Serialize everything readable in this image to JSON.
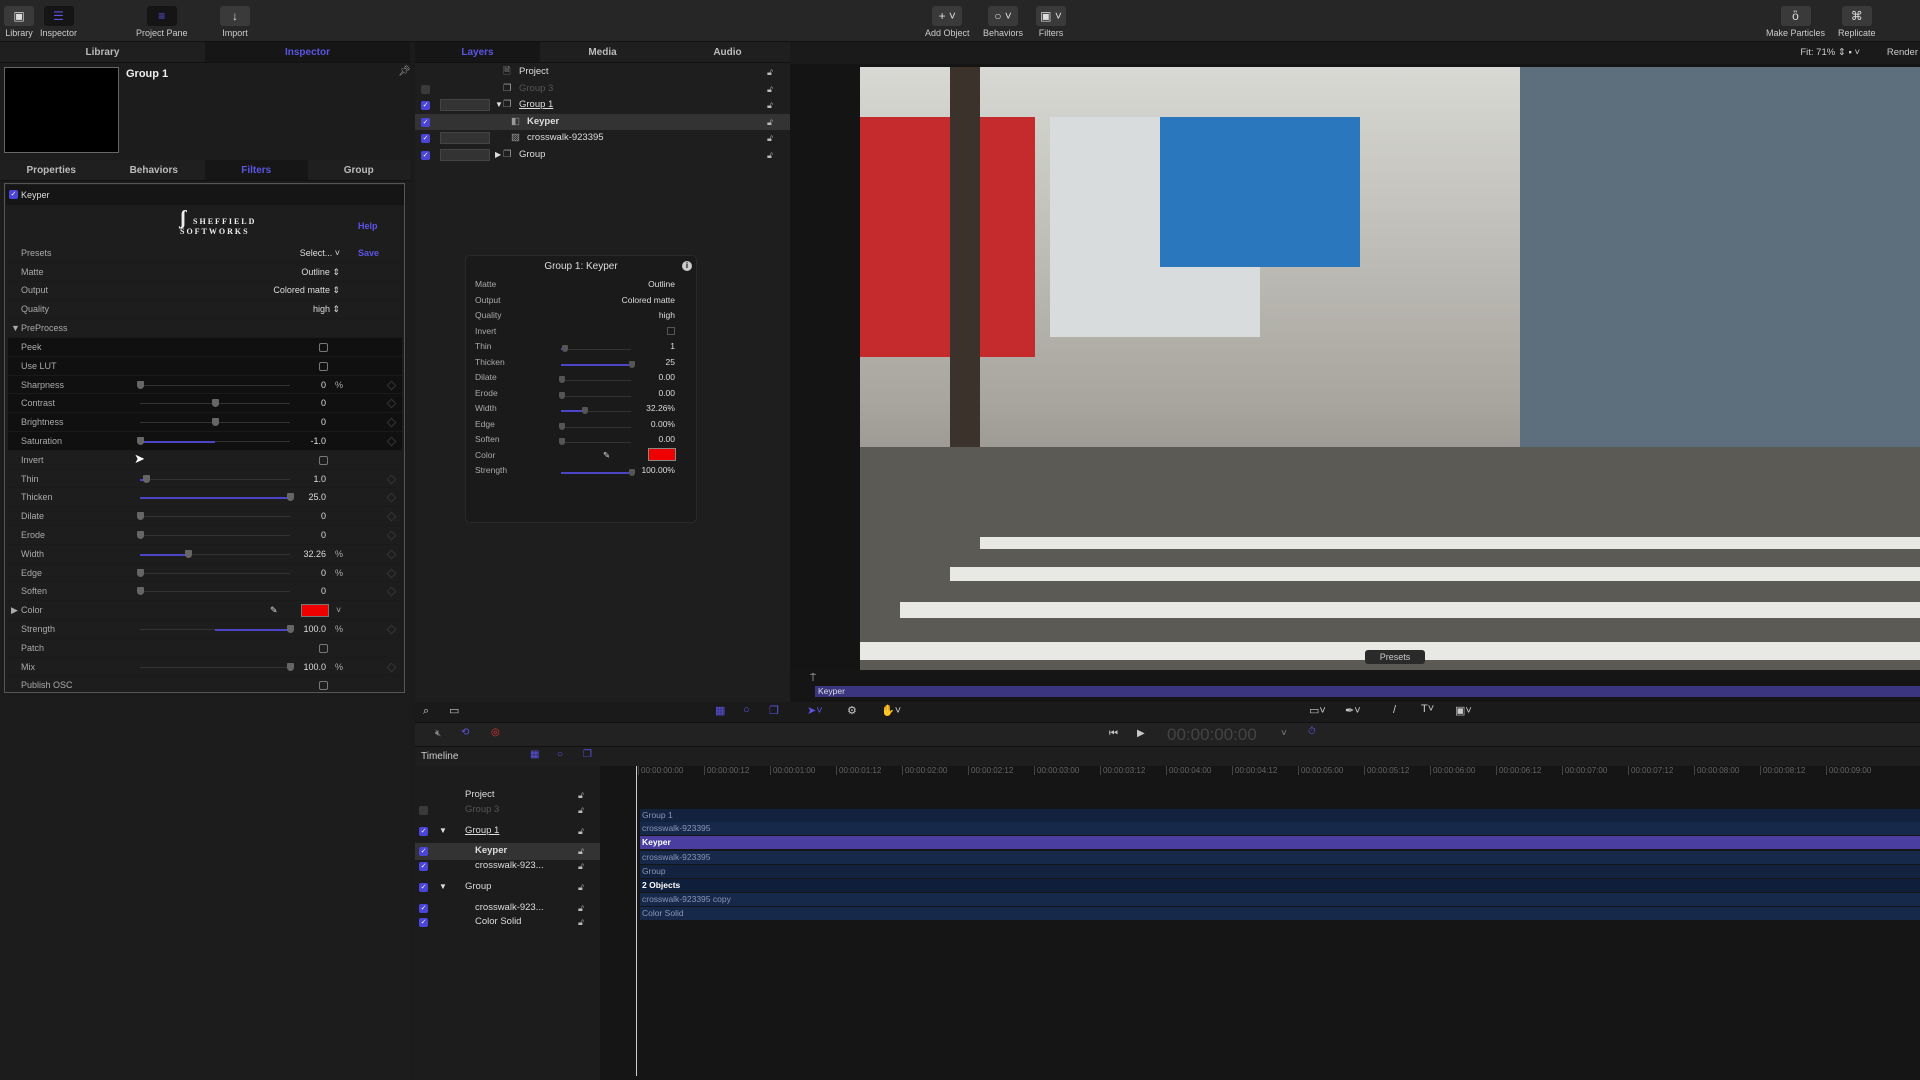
{
  "toolbar": {
    "left": [
      {
        "label": "Library",
        "icon": "library-icon"
      },
      {
        "label": "Inspector",
        "icon": "sliders-icon"
      },
      {
        "label": "Project Pane",
        "icon": "list-icon"
      },
      {
        "label": "Import",
        "icon": "arrow-down-icon"
      }
    ],
    "center": [
      {
        "label": "Add Object",
        "icon": "plus-icon"
      },
      {
        "label": "Behaviors",
        "icon": "gear-circle-icon"
      },
      {
        "label": "Filters",
        "icon": "filters-icon"
      }
    ],
    "right": [
      {
        "label": "Make Particles",
        "icon": "particles-icon"
      },
      {
        "label": "Replicate",
        "icon": "replicate-icon"
      }
    ]
  },
  "left_tabs": [
    "Library",
    "Inspector"
  ],
  "inspector": {
    "title": "Group 1",
    "subtabs": [
      "Properties",
      "Behaviors",
      "Filters",
      "Group"
    ],
    "filter": {
      "name": "Keyper",
      "brand": "SHEFFIELD SOFTWORKS",
      "help": "Help",
      "save": "Save",
      "presets": {
        "label": "Presets",
        "value": "Select..."
      },
      "matte": {
        "label": "Matte",
        "value": "Outline"
      },
      "output": {
        "label": "Output",
        "value": "Colored matte"
      },
      "quality": {
        "label": "Quality",
        "value": "high"
      },
      "preprocess": "PreProcess",
      "params": [
        {
          "label": "Peek",
          "type": "checkbox"
        },
        {
          "label": "Use LUT",
          "type": "checkbox"
        },
        {
          "label": "Sharpness",
          "type": "slider",
          "value": "0",
          "unit": "%",
          "fill_start": 0,
          "pos": 0
        },
        {
          "label": "Contrast",
          "type": "slider",
          "value": "0",
          "fill_start": 0.5,
          "pos": 0.5
        },
        {
          "label": "Brightness",
          "type": "slider",
          "value": "0",
          "fill_start": 0.5,
          "pos": 0.5
        },
        {
          "label": "Saturation",
          "type": "slider",
          "value": "-1.0",
          "fill_start": 0.5,
          "pos": 0
        },
        {
          "label": "Invert",
          "type": "checkbox"
        },
        {
          "label": "Thin",
          "type": "slider",
          "value": "1.0",
          "fill_start": 0,
          "pos": 0.04
        },
        {
          "label": "Thicken",
          "type": "slider",
          "value": "25.0",
          "fill_start": 0,
          "pos": 1
        },
        {
          "label": "Dilate",
          "type": "slider",
          "value": "0",
          "fill_start": 0,
          "pos": 0
        },
        {
          "label": "Erode",
          "type": "slider",
          "value": "0",
          "fill_start": 0,
          "pos": 0
        },
        {
          "label": "Width",
          "type": "slider",
          "value": "32.26",
          "unit": "%",
          "fill_start": 0,
          "pos": 0.3226
        },
        {
          "label": "Edge",
          "type": "slider",
          "value": "0",
          "unit": "%",
          "fill_start": 0,
          "pos": 0
        },
        {
          "label": "Soften",
          "type": "slider",
          "value": "0",
          "fill_start": 0,
          "pos": 0
        },
        {
          "label": "Color",
          "type": "color",
          "value": "#ee0000"
        },
        {
          "label": "Strength",
          "type": "slider",
          "value": "100.0",
          "unit": "%",
          "fill_start": 0.5,
          "pos": 1
        },
        {
          "label": "Patch",
          "type": "checkbox"
        },
        {
          "label": "Mix",
          "type": "slider",
          "value": "100.0",
          "unit": "%",
          "fill_start": 1,
          "pos": 1
        },
        {
          "label": "Publish OSC",
          "type": "checkbox"
        }
      ]
    }
  },
  "middle_tabs": [
    "Layers",
    "Media",
    "Audio"
  ],
  "layers": [
    {
      "name": "Project"
    },
    {
      "name": "Group 3",
      "enabled": false
    },
    {
      "name": "Group 1",
      "enabled": true
    },
    {
      "name": "Keyper",
      "enabled": true,
      "selected": true
    },
    {
      "name": "crosswalk-923395",
      "enabled": true
    },
    {
      "name": "Group",
      "enabled": true
    }
  ],
  "hud": {
    "title": "Group 1: Keyper",
    "rows": [
      {
        "label": "Matte",
        "value": "Outline"
      },
      {
        "label": "Output",
        "value": "Colored matte"
      },
      {
        "label": "Quality",
        "value": "high"
      },
      {
        "label": "Invert",
        "value": ""
      },
      {
        "label": "Thin",
        "value": "1",
        "pos": 0.04
      },
      {
        "label": "Thicken",
        "value": "25",
        "pos": 1
      },
      {
        "label": "Dilate",
        "value": "0.00",
        "pos": 0
      },
      {
        "label": "Erode",
        "value": "0.00",
        "pos": 0
      },
      {
        "label": "Width",
        "value": "32.26%",
        "pos": 0.3226
      },
      {
        "label": "Edge",
        "value": "0.00%",
        "pos": 0
      },
      {
        "label": "Soften",
        "value": "0.00",
        "pos": 0
      },
      {
        "label": "Color",
        "value": ""
      },
      {
        "label": "Strength",
        "value": "100.00%",
        "pos": 1
      }
    ]
  },
  "viewer": {
    "fit": "Fit: 71%",
    "render": "Render",
    "presets": "Presets",
    "mini_bar": "Keyper",
    "accent": "#5b55e6",
    "outline_color": "#ee0000"
  },
  "transport": {
    "timecode": "00:00:00:00"
  },
  "timeline": {
    "title": "Timeline",
    "ruler": [
      "00:00:00:00",
      "00:00:00:12",
      "00:00:01:00",
      "00:00:01:12",
      "00:00:02:00",
      "00:00:02:12",
      "00:00:03:00",
      "00:00:03:12",
      "00:00:04:00",
      "00:00:04:12",
      "00:00:05:00",
      "00:00:05:12",
      "00:00:06:00",
      "00:00:06:12",
      "00:00:07:00",
      "00:00:07:12",
      "00:00:08:00",
      "00:00:08:12",
      "00:00:09:00"
    ],
    "layers": [
      "Project",
      "Group 3",
      "Group 1",
      "Keyper",
      "crosswalk-923...",
      "Group",
      "crosswalk-923...",
      "Color Solid"
    ],
    "tracks": [
      "Group 1",
      "crosswalk-923395",
      "Keyper",
      "crosswalk-923395",
      "Group",
      "2 Objects",
      "crosswalk-923395 copy",
      "Color Solid"
    ]
  }
}
